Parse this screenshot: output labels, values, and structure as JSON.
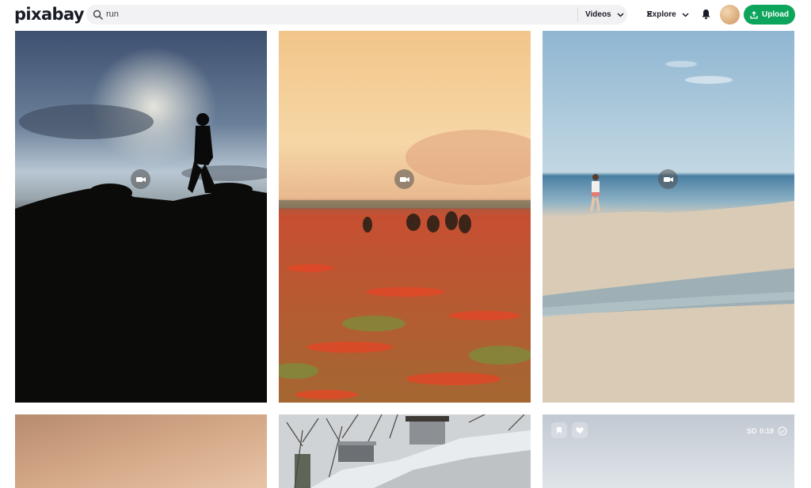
{
  "header": {
    "logo_text": "pixabay",
    "search": {
      "query": "run",
      "media_type": "Videos"
    },
    "explore_label": "Explore",
    "upload_label": "Upload"
  },
  "results": [
    {
      "subject": "Silhouette of man running at dusk",
      "type": "video"
    },
    {
      "subject": "Horses running through poppy field",
      "type": "video"
    },
    {
      "subject": "Woman running on beach",
      "type": "video"
    },
    {
      "subject": "Sunset sky",
      "type": "video"
    },
    {
      "subject": "Snowy hillside with shed",
      "type": "video"
    },
    {
      "subject": "Overcast sky",
      "type": "video",
      "quality": "SD",
      "duration": "0:18"
    }
  ],
  "colors": {
    "upload_green": "#0da45b",
    "search_bg": "#f2f2f4",
    "logo": "#191b26"
  }
}
